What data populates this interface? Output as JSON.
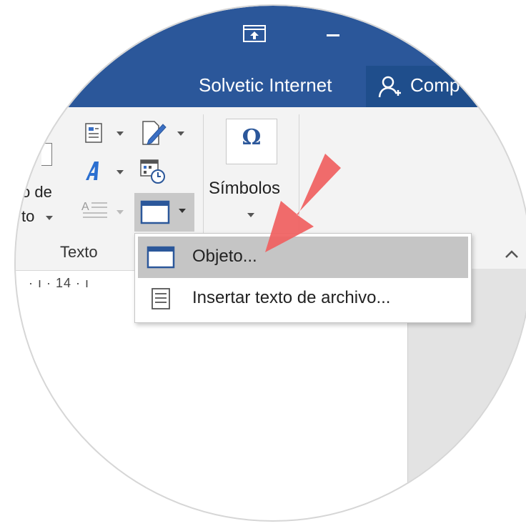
{
  "titlebar": {
    "account_name": "Solvetic Internet",
    "share_label": "Comp",
    "bg_color": "#2b579a"
  },
  "ribbon": {
    "textbox_line1": "o de",
    "textbox_line2": "to",
    "group_texto_label": "Texto",
    "symbols_glyph": "Ω",
    "symbols_label": "Símbolos"
  },
  "ruler": {
    "text": "· ı · 14 · ı"
  },
  "menu": {
    "items": [
      {
        "label": "Objeto...",
        "icon": "object-window-icon",
        "highlighted": true
      },
      {
        "label": "Insertar texto de archivo...",
        "icon": "text-file-icon",
        "highlighted": false
      }
    ]
  },
  "annotation": {
    "arrow_color": "#f06060"
  }
}
